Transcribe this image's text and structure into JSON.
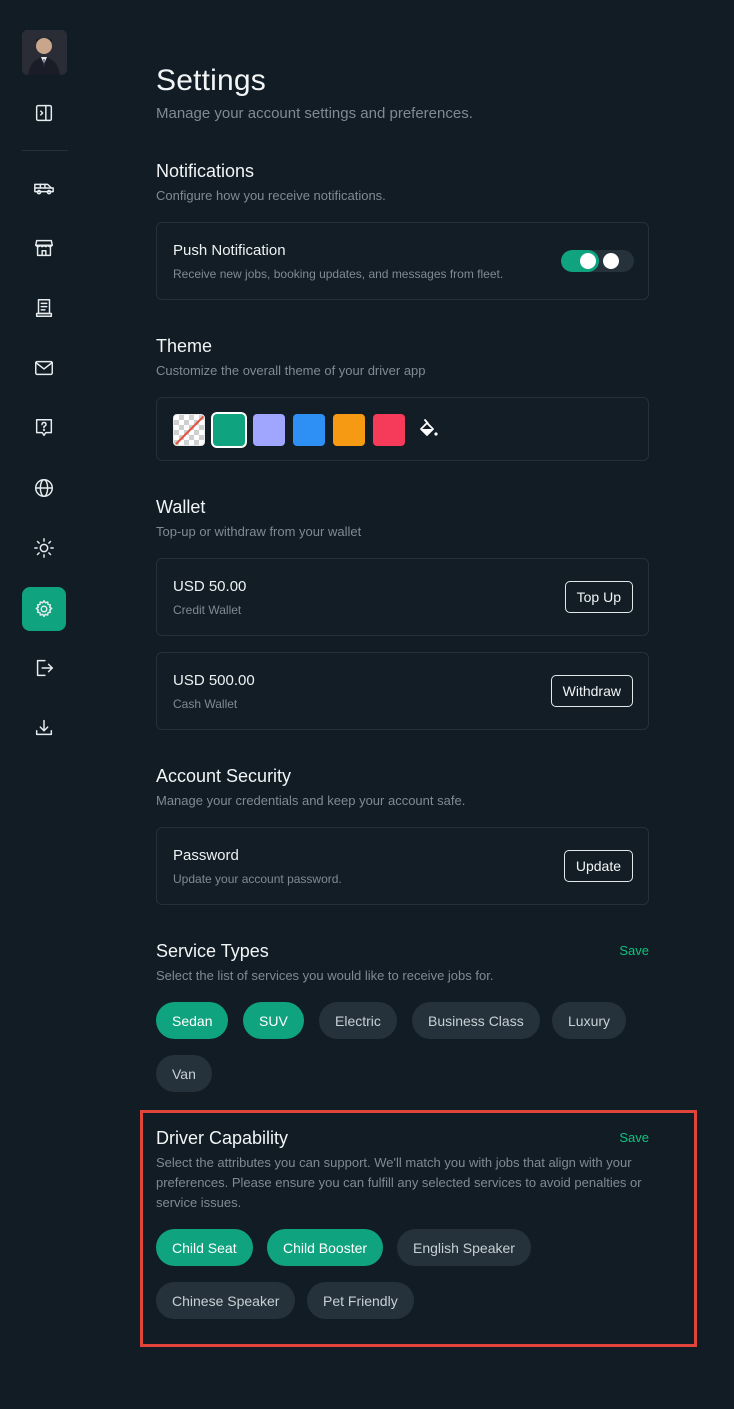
{
  "sidebar": {
    "items": [
      {
        "name": "panel-toggle-icon"
      },
      {
        "name": "vehicle-icon"
      },
      {
        "name": "store-icon"
      },
      {
        "name": "receipt-icon"
      },
      {
        "name": "mail-icon"
      },
      {
        "name": "help-icon"
      },
      {
        "name": "globe-icon"
      },
      {
        "name": "sun-icon"
      },
      {
        "name": "gear-icon",
        "active": true
      },
      {
        "name": "logout-icon"
      },
      {
        "name": "download-icon"
      }
    ]
  },
  "header": {
    "title": "Settings",
    "subtitle": "Manage your account settings and preferences."
  },
  "notifications": {
    "title": "Notifications",
    "subtitle": "Configure how you receive notifications.",
    "push_title": "Push Notification",
    "push_desc": "Receive new jobs, booking updates, and messages from fleet.",
    "push_enabled": true
  },
  "theme": {
    "title": "Theme",
    "subtitle": "Customize the overall theme of your driver app",
    "swatches": [
      "none",
      "#10a37f",
      "#a0a5fd",
      "#2e8ff5",
      "#f59a12",
      "#f53a5a"
    ],
    "selected": "#10a37f",
    "custom_icon": "paint-bucket-icon"
  },
  "wallet": {
    "title": "Wallet",
    "subtitle": "Top-up or withdraw from your wallet",
    "credit_amount": "USD 50.00",
    "credit_label": "Credit Wallet",
    "topup_label": "Top Up",
    "cash_amount": "USD 500.00",
    "cash_label": "Cash Wallet",
    "withdraw_label": "Withdraw"
  },
  "security": {
    "title": "Account Security",
    "subtitle": "Manage your credentials and keep your account safe.",
    "password_title": "Password",
    "password_desc": "Update your account password.",
    "update_label": "Update"
  },
  "service_types": {
    "title": "Service Types",
    "subtitle": "Select the list of services you would like to receive jobs for.",
    "save_label": "Save",
    "options": [
      {
        "label": "Sedan",
        "selected": true
      },
      {
        "label": "SUV",
        "selected": true
      },
      {
        "label": "Electric",
        "selected": false
      },
      {
        "label": "Business Class",
        "selected": false
      },
      {
        "label": "Luxury",
        "selected": false
      },
      {
        "label": "Van",
        "selected": false
      }
    ]
  },
  "capability": {
    "title": "Driver Capability",
    "subtitle": "Select the attributes you can support. We'll match you with jobs that align with your preferences. Please ensure you can fulfill any selected services to avoid penalties or service issues.",
    "save_label": "Save",
    "options": [
      {
        "label": "Child Seat",
        "selected": true
      },
      {
        "label": "Child Booster",
        "selected": true
      },
      {
        "label": "English Speaker",
        "selected": false
      },
      {
        "label": "Chinese Speaker",
        "selected": false
      },
      {
        "label": "Pet Friendly",
        "selected": false
      }
    ]
  },
  "colors": {
    "background": "#111c24",
    "accent": "#10a37f",
    "save_link": "#10c27e",
    "highlight": "#e0443a"
  }
}
